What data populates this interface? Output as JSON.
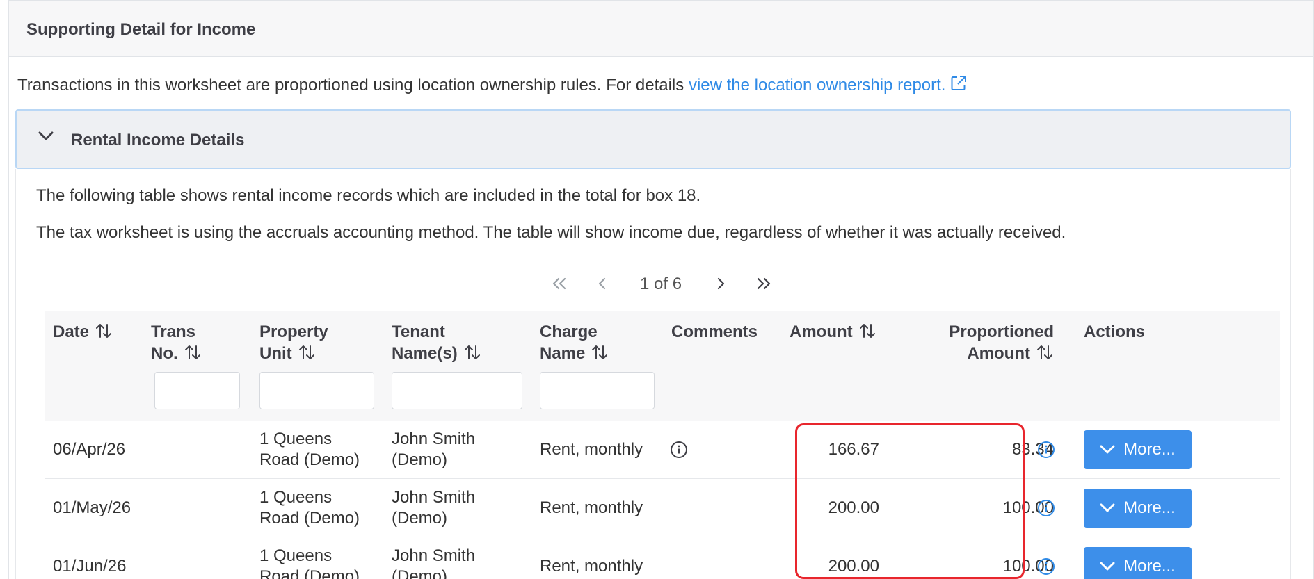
{
  "card": {
    "title": "Supporting Detail for Income",
    "intro_text": "Transactions in this worksheet are proportioned using location ownership rules. For details ",
    "intro_link": "view the location ownership report."
  },
  "accordion": {
    "title": "Rental Income Details",
    "para1": "The following table shows rental income records which are included in the total for box 18.",
    "para2": "The tax worksheet is using the accruals accounting method. The table will show income due, regardless of whether it was actually received."
  },
  "pager": {
    "text": "1 of 6"
  },
  "table": {
    "headers": {
      "date": "Date",
      "trans1": "Trans",
      "trans2": "No.",
      "prop1": "Property",
      "prop2": "Unit",
      "tenant1": "Tenant",
      "tenant2": "Name(s)",
      "charge1": "Charge",
      "charge2": "Name",
      "comments": "Comments",
      "amount": "Amount",
      "prop_amount1": "Proportioned",
      "prop_amount2": "Amount",
      "actions": "Actions"
    },
    "rows": [
      {
        "date": "06/Apr/26",
        "prop1": "1 Queens",
        "prop2": "Road (Demo)",
        "tenant1": "John Smith",
        "tenant2": "(Demo)",
        "charge": "Rent, monthly",
        "amount": "166.67",
        "proportioned": "83.34",
        "more": "More..."
      },
      {
        "date": "01/May/26",
        "prop1": "1 Queens",
        "prop2": "Road (Demo)",
        "tenant1": "John Smith",
        "tenant2": "(Demo)",
        "charge": "Rent, monthly",
        "amount": "200.00",
        "proportioned": "100.00",
        "more": "More..."
      },
      {
        "date": "01/Jun/26",
        "prop1": "1 Queens",
        "prop2": "Road (Demo)",
        "tenant1": "John Smith",
        "tenant2": "(Demo)",
        "charge": "Rent, monthly",
        "amount": "200.00",
        "proportioned": "100.00",
        "more": "More..."
      }
    ]
  },
  "colors": {
    "link": "#2f8ae6",
    "button": "#3d8fea",
    "highlight": "#e8262d"
  },
  "icons": [
    "external-link-icon",
    "chevron-down-icon",
    "first-page-icon",
    "prev-page-icon",
    "next-page-icon",
    "last-page-icon",
    "sort-icon",
    "info-icon"
  ]
}
